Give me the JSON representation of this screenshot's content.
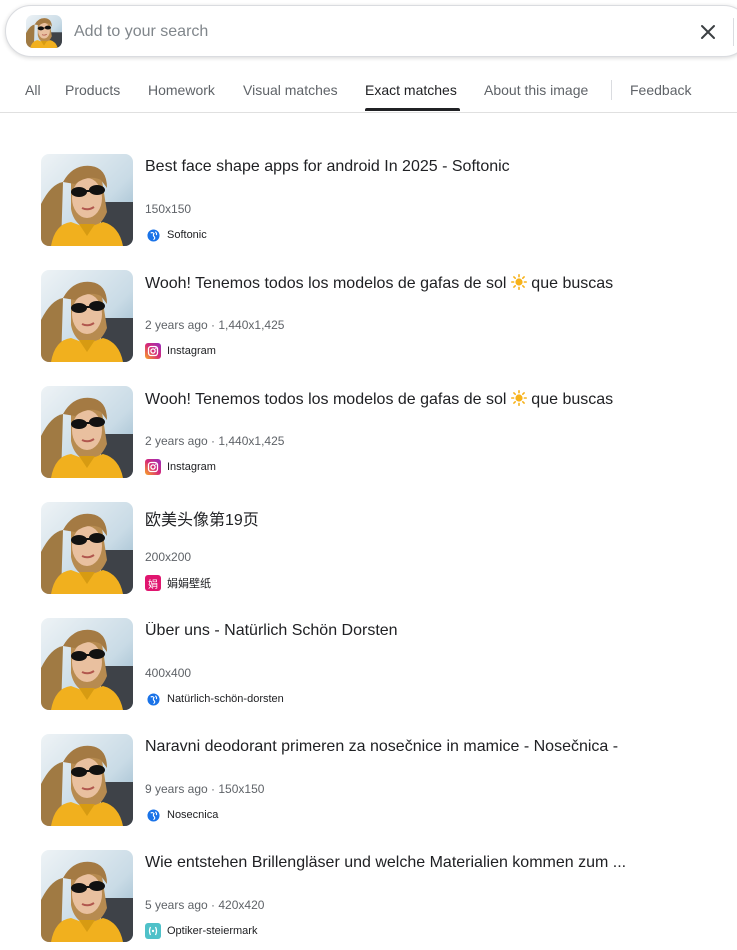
{
  "search": {
    "placeholder": "Add to your search",
    "value": ""
  },
  "tabs": [
    {
      "label": "All"
    },
    {
      "label": "Products"
    },
    {
      "label": "Homework"
    },
    {
      "label": "Visual matches"
    },
    {
      "label": "Exact matches",
      "active": true
    },
    {
      "label": "About this image"
    },
    {
      "label": "Feedback"
    }
  ],
  "results": [
    {
      "title": "Best face shape apps for android In 2025 - Softonic",
      "meta": "150x150",
      "source": "Softonic",
      "favicon": "globe-icon"
    },
    {
      "title_pre": "Wooh! Tenemos todos los modelos de gafas de sol",
      "title_post": " que buscas",
      "meta": "2 years ago · 1,440x1,425",
      "source": "Instagram",
      "favicon": "instagram-icon"
    },
    {
      "title_pre": "Wooh! Tenemos todos los modelos de gafas de sol",
      "title_post": " que buscas",
      "meta": "2 years ago · 1,440x1,425",
      "source": "Instagram",
      "favicon": "instagram-icon"
    },
    {
      "title": "欧美头像第19页",
      "meta": "200x200",
      "source": "娟娟壁纸",
      "favicon": "juanjuan-icon",
      "favicon_char": "娟"
    },
    {
      "title": "Über uns - Natürlich Schön Dorsten",
      "meta": "400x400",
      "source": "Natürlich-schön-dorsten",
      "favicon": "globe-icon"
    },
    {
      "title": "Naravni deodorant primeren za nosečnice in mamice - Nosečnica -",
      "meta": "9 years ago · 150x150",
      "source": "Nosecnica",
      "favicon": "globe-icon"
    },
    {
      "title": "Wie entstehen Brillengläser und welche Materialien kommen zum ...",
      "meta": "5 years ago · 420x420",
      "source": "Optiker-steiermark",
      "favicon": "optiker-icon"
    }
  ],
  "colors": {
    "accent": "#202124",
    "globe": "#1a73e8",
    "instagram": "#d62976",
    "juanjuan": "#e0156f",
    "optiker": "#4fc1c9"
  }
}
